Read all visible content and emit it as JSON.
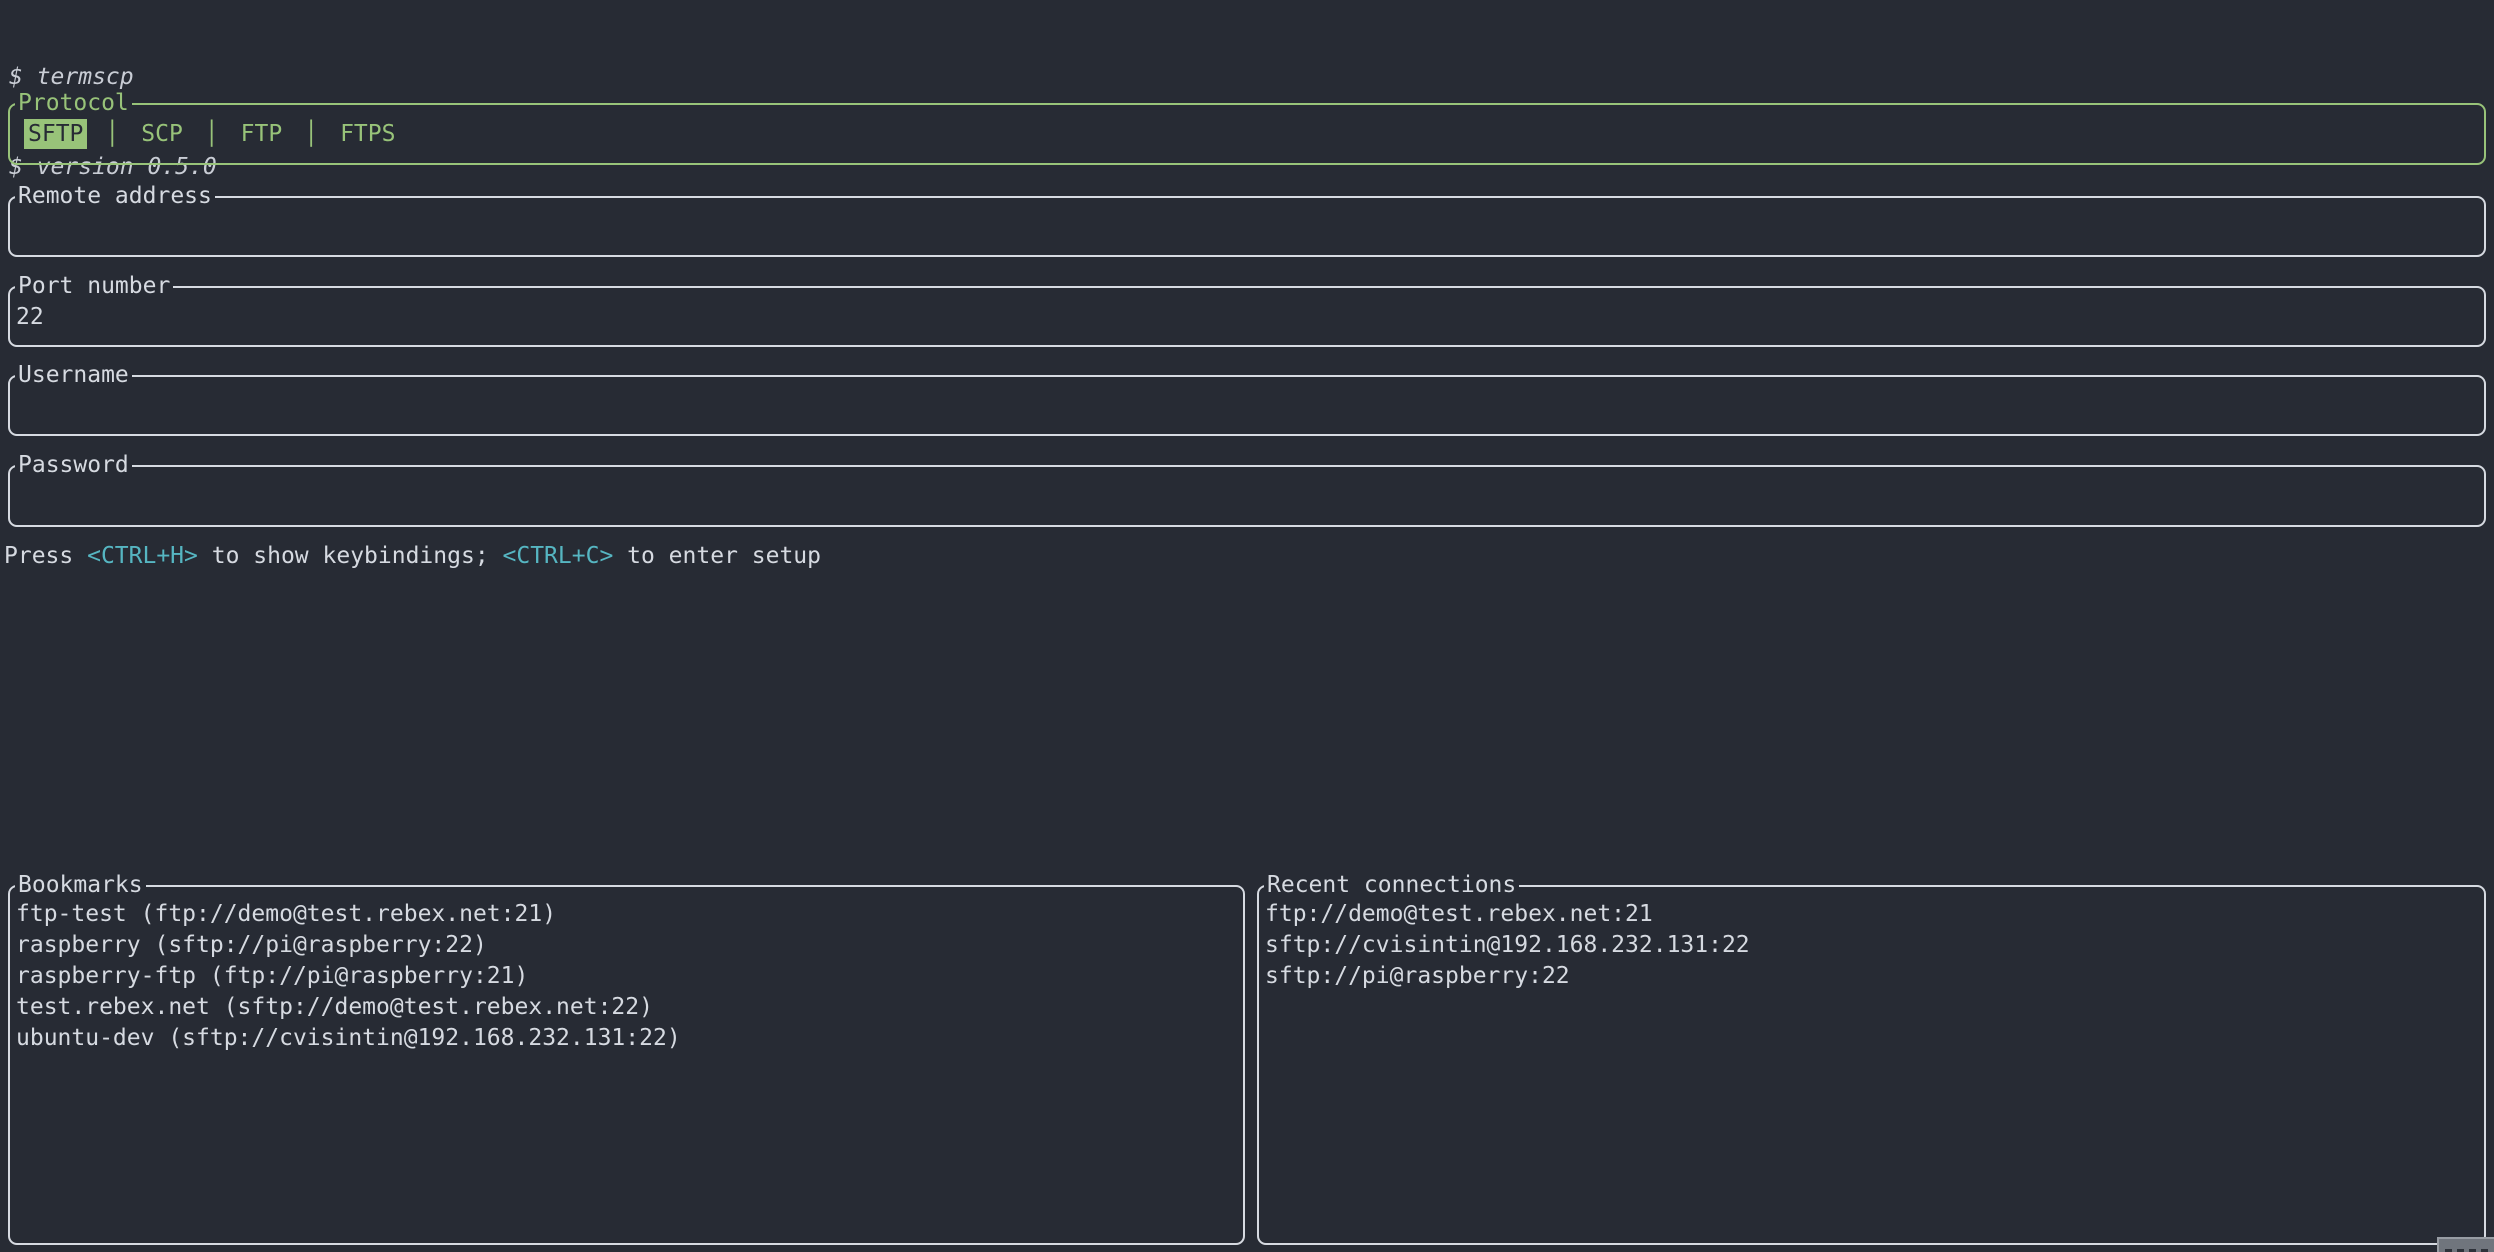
{
  "terminal": {
    "lines": [
      "$ termscp",
      "$ version 0.5.0"
    ]
  },
  "protocol": {
    "title": "Protocol",
    "divider": "│",
    "tabs": [
      {
        "label": "SFTP",
        "selected": true
      },
      {
        "label": "SCP",
        "selected": false
      },
      {
        "label": "FTP",
        "selected": false
      },
      {
        "label": "FTPS",
        "selected": false
      }
    ]
  },
  "fields": [
    {
      "title": "Remote address",
      "value": ""
    },
    {
      "title": "Port number",
      "value": "22"
    },
    {
      "title": "Username",
      "value": ""
    },
    {
      "title": "Password",
      "value": ""
    }
  ],
  "help": {
    "prefix": "Press ",
    "key1": "<CTRL+H>",
    "middle": " to show keybindings; ",
    "key2": "<CTRL+C>",
    "suffix": " to enter setup"
  },
  "bookmarks": {
    "title": "Bookmarks",
    "items": [
      "ftp-test (ftp://demo@test.rebex.net:21)",
      "raspberry (sftp://pi@raspberry:22)",
      "raspberry-ftp (ftp://pi@raspberry:21)",
      "test.rebex.net (sftp://demo@test.rebex.net:22)",
      "ubuntu-dev (sftp://cvisintin@192.168.232.131:22)"
    ]
  },
  "recent": {
    "title": "Recent connections",
    "items": [
      "ftp://demo@test.rebex.net:21",
      "sftp://cvisintin@192.168.232.131:22",
      "sftp://pi@raspberry:22"
    ]
  },
  "colors": {
    "background": "#272b34",
    "foreground": "#d6dae1",
    "dim_foreground": "#c9cdd5",
    "green": "#98c379",
    "cyan": "#56b6c2",
    "selected_tab_text": "#272b34",
    "tooltip_gray": "#70757d"
  }
}
